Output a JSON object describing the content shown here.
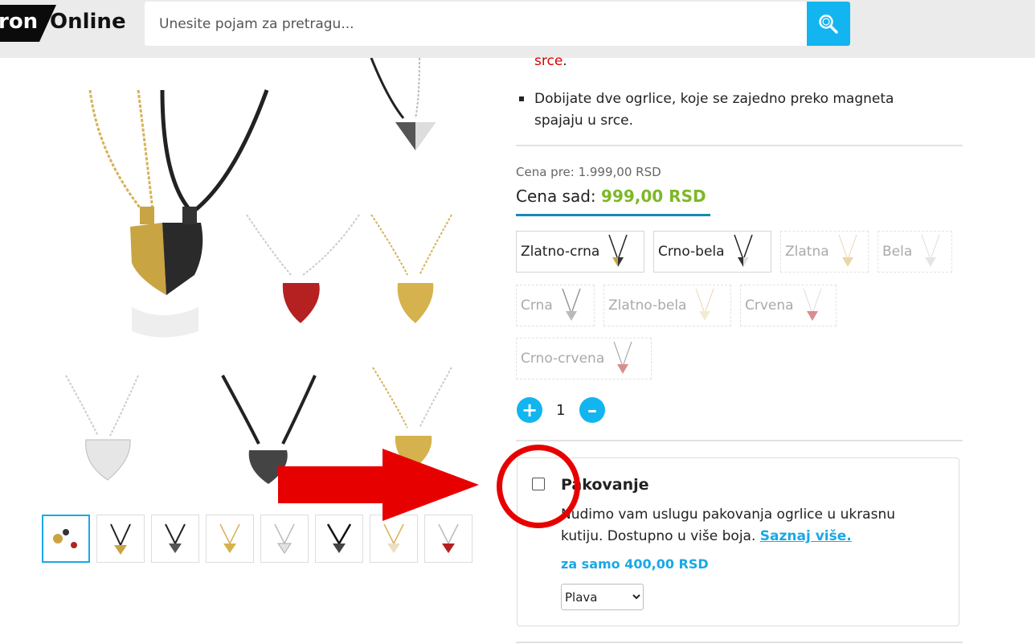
{
  "header": {
    "logo_left": "ron",
    "logo_right": "Online",
    "search_placeholder": "Unesite pojam za pretragu...",
    "search_icon": "search-icon"
  },
  "description": {
    "prev_line_red": "srce",
    "prev_line_tail": ".",
    "bullet": "Dobijate dve ogrlice, koje se zajedno preko magneta spajaju u srce."
  },
  "price": {
    "old": "Cena pre: 1.999,00 RSD",
    "now_label": "Cena sad: ",
    "now_value": "999,00 RSD"
  },
  "variants": [
    {
      "label": "Zlatno-crna",
      "active": true
    },
    {
      "label": "Crno-bela",
      "active": true
    },
    {
      "label": "Zlatna",
      "active": false
    },
    {
      "label": "Bela",
      "active": false
    },
    {
      "label": "Crna",
      "active": false
    },
    {
      "label": "Zlatno-bela",
      "active": false
    },
    {
      "label": "Crvena",
      "active": false
    },
    {
      "label": "Crno-crvena",
      "active": false
    }
  ],
  "quantity": {
    "value": "1",
    "plus": "+",
    "minus": "–"
  },
  "packaging": {
    "title": "Pakovanje",
    "description": "Nudimo vam uslugu pakovanja ogrlice u ukrasnu kutiju. Dostupno u više boja. ",
    "link": "Saznaj više.",
    "price": "za samo 400,00 RSD",
    "select_value": "Plava",
    "checked": false
  },
  "colors": {
    "accent": "#12b5f0",
    "price_green": "#7cb827",
    "annotation_red": "#e70000"
  }
}
